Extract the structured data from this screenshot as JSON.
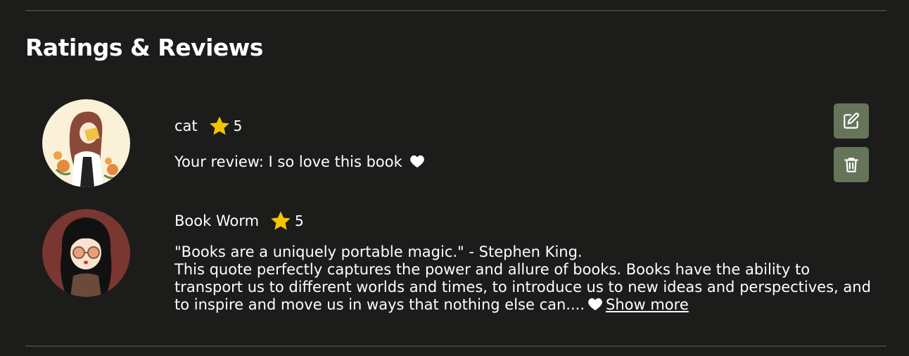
{
  "section": {
    "title": "Ratings & Reviews"
  },
  "colors": {
    "background": "#1c1c1b",
    "button": "#667459",
    "star": "#f5c400",
    "divider": "#3f4238"
  },
  "reviews": [
    {
      "user": "cat",
      "rating": "5",
      "text": "Your review: I so love this book",
      "own_review": true,
      "actions": {
        "edit_icon": "edit-icon",
        "delete_icon": "trash-icon"
      }
    },
    {
      "user": "Book Worm",
      "rating": "5",
      "text_line1": "\"Books are a uniquely portable magic.\" - Stephen King.",
      "text_rest": "This quote perfectly captures the power and allure of books. Books have the ability to transport us to different worlds and times, to introduce us to new ideas and perspectives, and to inspire and move us in ways that nothing else can....",
      "show_more_label": "Show more"
    }
  ]
}
